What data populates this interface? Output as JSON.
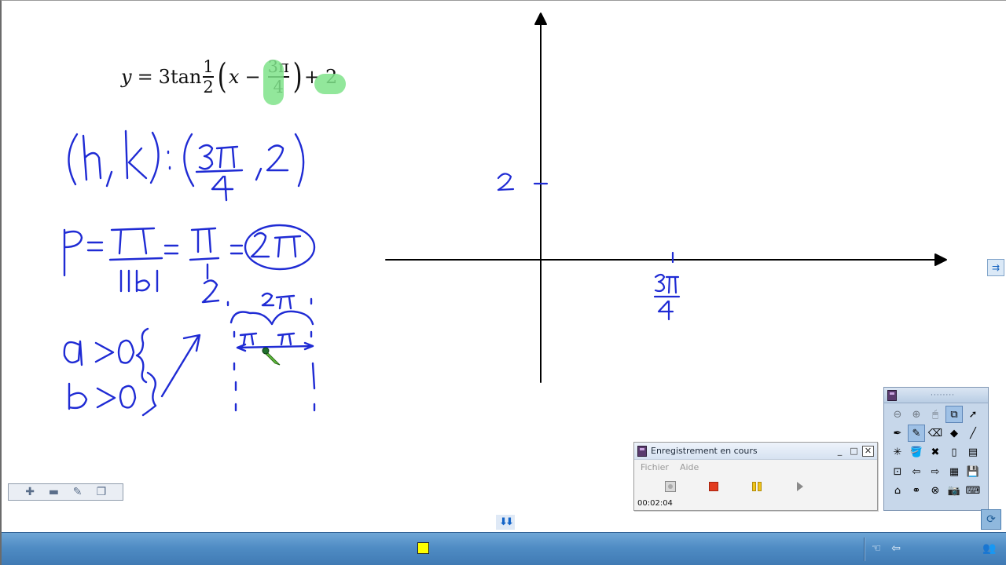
{
  "equation": {
    "lhs": "y",
    "equals": "=",
    "coefficient": "3",
    "func": "tan",
    "frac_num": "1",
    "frac_den": "2",
    "open_paren": "(",
    "x": "x",
    "minus": "−",
    "shift_num": "3π",
    "shift_den": "4",
    "close_paren": ")",
    "plus": "+",
    "vshift": "2",
    "highlight_color": "#7fe38a"
  },
  "ink_color": "#1f2bd4",
  "slide_toolbar": {
    "icons": [
      "plus-icon",
      "minus-icon",
      "edit-icon",
      "copy-page-icon"
    ],
    "glyphs": [
      "✚",
      "▬",
      "✎",
      "❐"
    ]
  },
  "page_nav": {
    "glyph": "⬇⬇"
  },
  "recorder": {
    "title": "Enregistrement en cours",
    "minimize": "_",
    "maximize": "□",
    "close": "✕",
    "menu": [
      "Fichier",
      "Aide"
    ],
    "time": "00:02:04",
    "stop_color": "#e23b1e",
    "pause_color": "#f0c419"
  },
  "palette": {
    "grip": "········",
    "tools": [
      {
        "name": "zoom-out-icon",
        "glyph": "⊖",
        "dim": true
      },
      {
        "name": "zoom-in-icon",
        "glyph": "⊕",
        "dim": true
      },
      {
        "name": "mouse-icon",
        "glyph": "🖱",
        "dim": true
      },
      {
        "name": "page-capture-icon",
        "glyph": "⧉",
        "active": true
      },
      {
        "name": "select-arrow-icon",
        "glyph": "➚"
      },
      {
        "name": "pen-icon",
        "glyph": "✒"
      },
      {
        "name": "highlighter-icon",
        "glyph": "✎",
        "active": true
      },
      {
        "name": "eraser-icon",
        "glyph": "⌫"
      },
      {
        "name": "shapes-icon",
        "glyph": "◆"
      },
      {
        "name": "line-icon",
        "glyph": "╱"
      },
      {
        "name": "magic-pen-icon",
        "glyph": "✳"
      },
      {
        "name": "fill-icon",
        "glyph": "🪣"
      },
      {
        "name": "clear-icon",
        "glyph": "✖"
      },
      {
        "name": "blank-page-icon",
        "glyph": "▯"
      },
      {
        "name": "page-icon",
        "glyph": "▤"
      },
      {
        "name": "screen-capture-icon",
        "glyph": "⊡"
      },
      {
        "name": "undo-icon",
        "glyph": "⇦"
      },
      {
        "name": "redo-icon",
        "glyph": "⇨"
      },
      {
        "name": "table-icon",
        "glyph": "▦"
      },
      {
        "name": "save-icon",
        "glyph": "💾"
      },
      {
        "name": "desktop-icon",
        "glyph": "⌂"
      },
      {
        "name": "link-icon",
        "glyph": "⚭"
      },
      {
        "name": "close-tools-icon",
        "glyph": "⊗"
      },
      {
        "name": "camera-icon",
        "glyph": "📷"
      },
      {
        "name": "keyboard-icon",
        "glyph": "⌨"
      }
    ]
  },
  "taskbar": {
    "square_color": "#ffff00",
    "tray": [
      {
        "name": "hand-icon",
        "glyph": "☜"
      },
      {
        "name": "back-arrow-icon",
        "glyph": "⇦"
      },
      {
        "name": "users-icon",
        "glyph": "👥"
      }
    ]
  },
  "side_buttons": {
    "expand_glyph": "⇉",
    "refresh_glyph": "⟳"
  }
}
